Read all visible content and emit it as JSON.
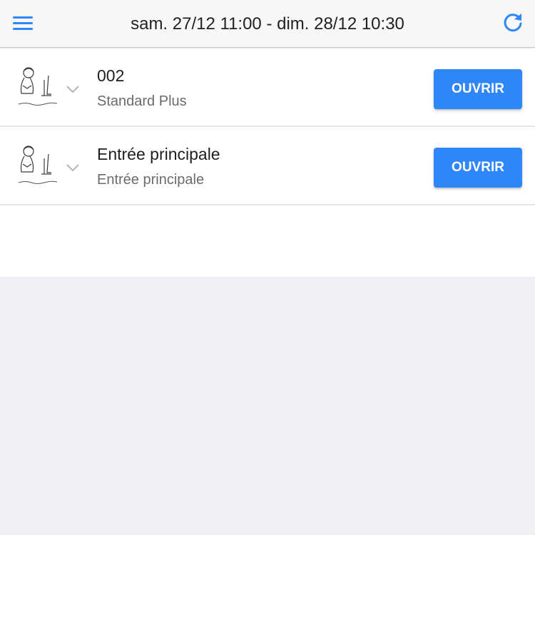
{
  "header": {
    "title": "sam. 27/12 11:00 - dim. 28/12 10:30",
    "menu_icon": "hamburger-menu-icon",
    "refresh_icon": "refresh-icon"
  },
  "colors": {
    "accent": "#2f86f6",
    "header_bg": "#f7f7f8",
    "empty_area": "#efeff4"
  },
  "items": [
    {
      "title": "002",
      "subtitle": "Standard Plus",
      "button_label": "OUVRIR",
      "image": "hotel-logo-sketch"
    },
    {
      "title": "Entrée principale",
      "subtitle": "Entrée principale",
      "button_label": "OUVRIR",
      "image": "hotel-logo-sketch"
    }
  ]
}
